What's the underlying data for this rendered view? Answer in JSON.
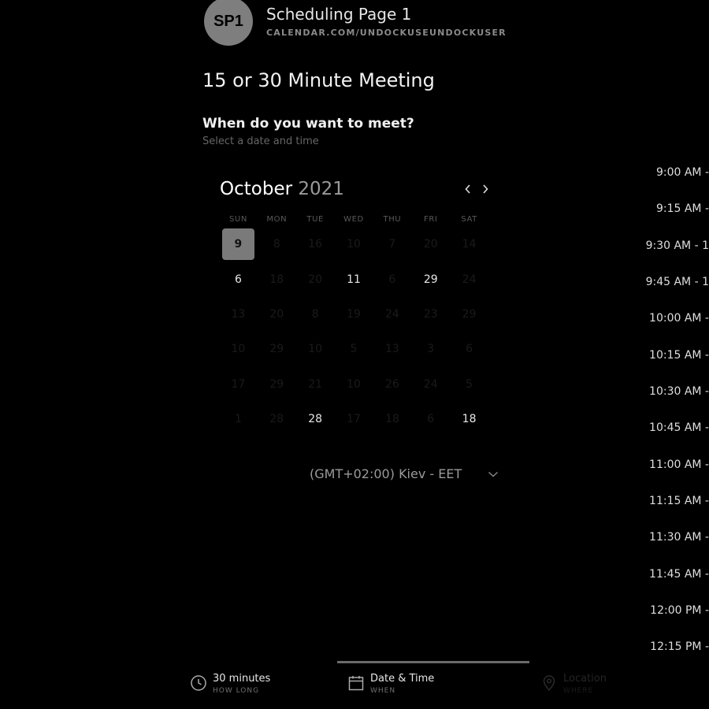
{
  "header": {
    "avatar_initials": "SP1",
    "page_name": "Scheduling Page 1",
    "url": "CALENDAR.COM/UNDOCKUSEUNDOCKUSER"
  },
  "meeting_title": "15 or 30 Minute Meeting",
  "question": "When do you want to meet?",
  "question_sub": "Select a date and time",
  "calendar": {
    "month": "October",
    "year": "2021",
    "weekdays": [
      "SUN",
      "MON",
      "TUE",
      "WED",
      "THU",
      "FRI",
      "SAT"
    ],
    "weeks": [
      [
        {
          "d": "9",
          "s": "selected"
        },
        {
          "d": "8",
          "s": "na"
        },
        {
          "d": "16",
          "s": "na"
        },
        {
          "d": "10",
          "s": "na"
        },
        {
          "d": "7",
          "s": "na"
        },
        {
          "d": "20",
          "s": "na"
        },
        {
          "d": "14",
          "s": "na"
        }
      ],
      [
        {
          "d": "6",
          "s": "avail"
        },
        {
          "d": "18",
          "s": "na"
        },
        {
          "d": "20",
          "s": "na"
        },
        {
          "d": "11",
          "s": "avail"
        },
        {
          "d": "6",
          "s": "na"
        },
        {
          "d": "29",
          "s": "avail"
        },
        {
          "d": "24",
          "s": "na"
        }
      ],
      [
        {
          "d": "13",
          "s": "na"
        },
        {
          "d": "20",
          "s": "na"
        },
        {
          "d": "8",
          "s": "na"
        },
        {
          "d": "19",
          "s": "na"
        },
        {
          "d": "24",
          "s": "na"
        },
        {
          "d": "23",
          "s": "na"
        },
        {
          "d": "29",
          "s": "na"
        }
      ],
      [
        {
          "d": "10",
          "s": "na"
        },
        {
          "d": "29",
          "s": "na"
        },
        {
          "d": "10",
          "s": "na"
        },
        {
          "d": "5",
          "s": "na"
        },
        {
          "d": "13",
          "s": "na"
        },
        {
          "d": "3",
          "s": "na"
        },
        {
          "d": "6",
          "s": "na"
        }
      ],
      [
        {
          "d": "17",
          "s": "na"
        },
        {
          "d": "29",
          "s": "na"
        },
        {
          "d": "21",
          "s": "na"
        },
        {
          "d": "10",
          "s": "na"
        },
        {
          "d": "26",
          "s": "na"
        },
        {
          "d": "24",
          "s": "na"
        },
        {
          "d": "5",
          "s": "na"
        }
      ],
      [
        {
          "d": "1",
          "s": "na"
        },
        {
          "d": "28",
          "s": "na"
        },
        {
          "d": "28",
          "s": "avail"
        },
        {
          "d": "17",
          "s": "na"
        },
        {
          "d": "18",
          "s": "na"
        },
        {
          "d": "6",
          "s": "na"
        },
        {
          "d": "18",
          "s": "avail"
        }
      ]
    ]
  },
  "timezone": "(GMT+02:00) Kiev - EET",
  "time_slots": [
    "9:00 AM -",
    "9:15 AM -",
    "9:30 AM - 1",
    "9:45 AM - 1",
    "10:00 AM -",
    "10:15 AM -",
    "10:30 AM -",
    "10:45 AM -",
    "11:00 AM -",
    "11:15 AM -",
    "11:30 AM -",
    "11:45 AM -",
    "12:00 PM -",
    "12:15 PM -"
  ],
  "tabs": {
    "duration": {
      "label": "30 minutes",
      "sub": "HOW LONG",
      "icon": "clock-icon"
    },
    "datetime": {
      "label": "Date & Time",
      "sub": "WHEN",
      "icon": "calendar-icon"
    },
    "location": {
      "label": "Location",
      "sub": "WHERE",
      "icon": "map-pin-icon"
    }
  }
}
